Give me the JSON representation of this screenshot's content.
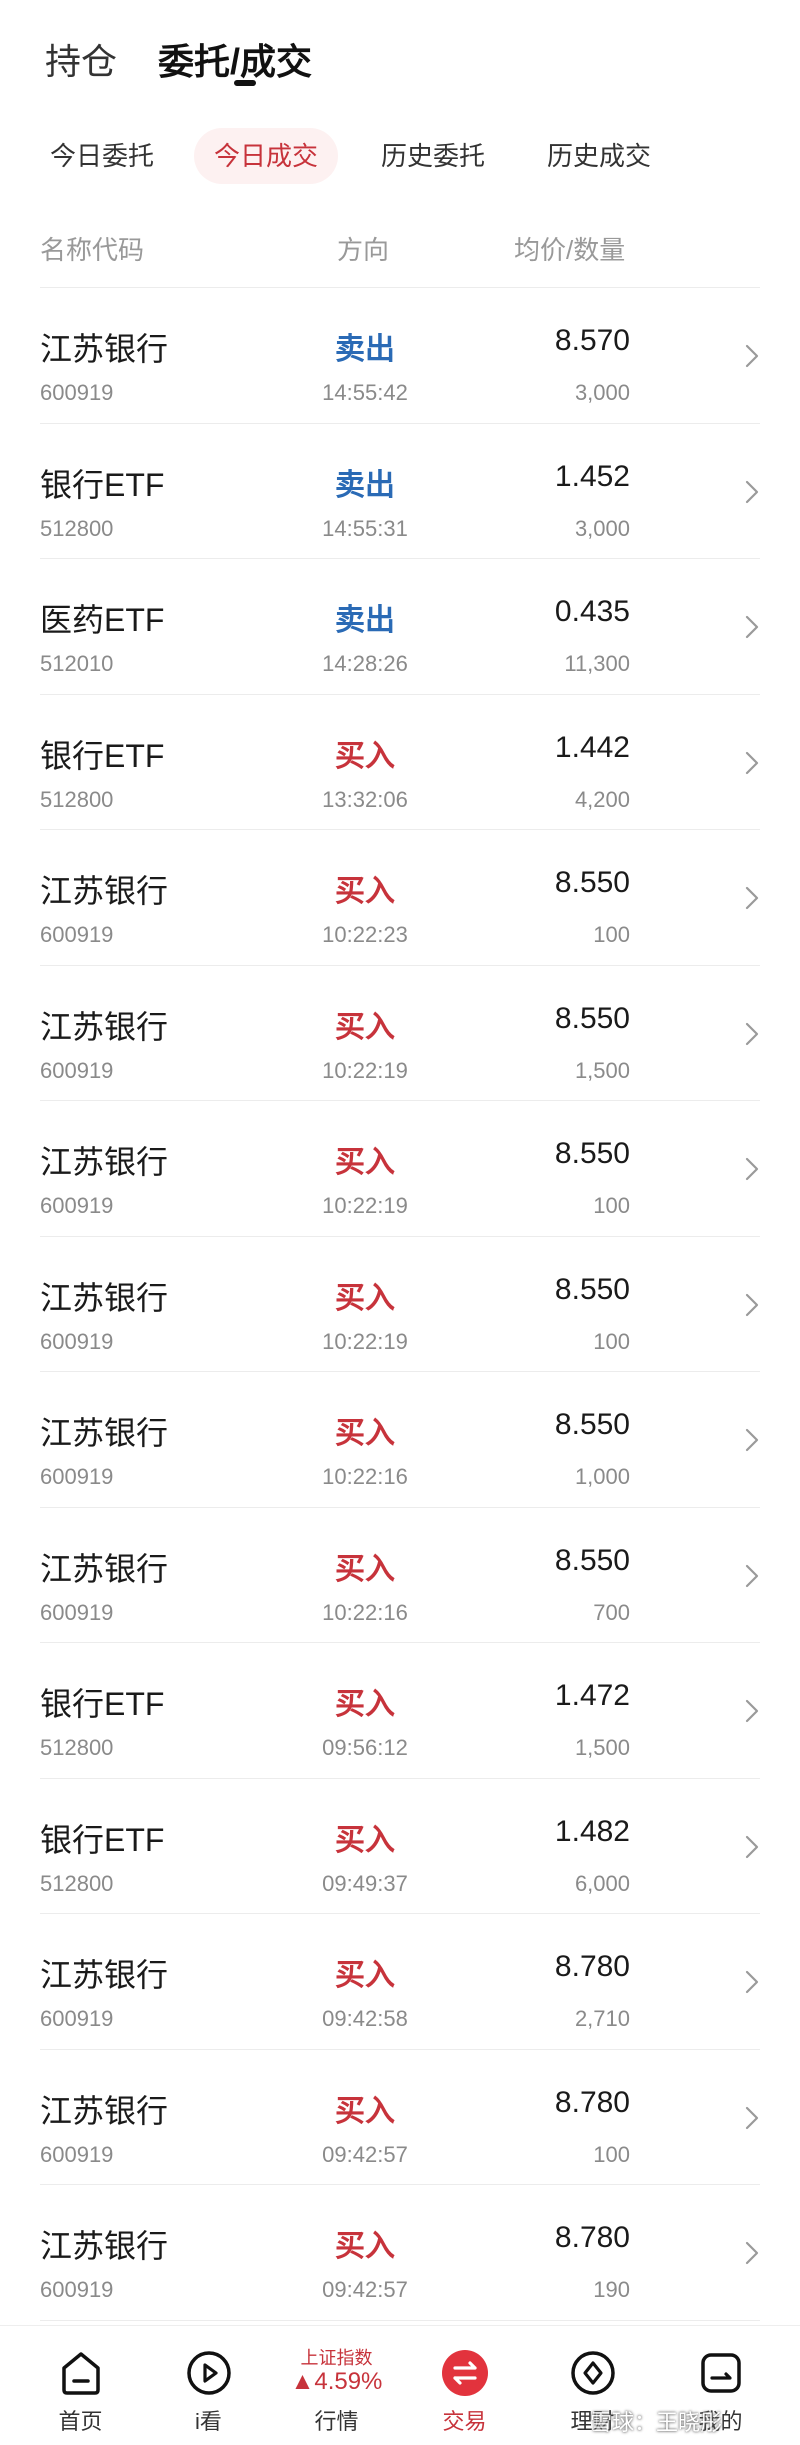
{
  "top_tabs": {
    "holdings": "持仓",
    "orders": "委托/成交"
  },
  "sub_tabs": [
    "今日委托",
    "今日成交",
    "历史委托",
    "历史成交"
  ],
  "active_sub_tab": 1,
  "columns": {
    "name_code": "名称代码",
    "direction": "方向",
    "price_qty": "均价/数量"
  },
  "colors": {
    "buy": "#c7333b",
    "sell": "#2a6ab5",
    "active_tab_bg": "#fdf1f1"
  },
  "trades": [
    {
      "name": "江苏银行",
      "code": "600919",
      "direction": "卖出",
      "side": "sell",
      "time": "14:55:42",
      "price": "8.570",
      "qty": "3,000"
    },
    {
      "name": "银行ETF",
      "code": "512800",
      "direction": "卖出",
      "side": "sell",
      "time": "14:55:31",
      "price": "1.452",
      "qty": "3,000"
    },
    {
      "name": "医药ETF",
      "code": "512010",
      "direction": "卖出",
      "side": "sell",
      "time": "14:28:26",
      "price": "0.435",
      "qty": "11,300"
    },
    {
      "name": "银行ETF",
      "code": "512800",
      "direction": "买入",
      "side": "buy",
      "time": "13:32:06",
      "price": "1.442",
      "qty": "4,200"
    },
    {
      "name": "江苏银行",
      "code": "600919",
      "direction": "买入",
      "side": "buy",
      "time": "10:22:23",
      "price": "8.550",
      "qty": "100"
    },
    {
      "name": "江苏银行",
      "code": "600919",
      "direction": "买入",
      "side": "buy",
      "time": "10:22:19",
      "price": "8.550",
      "qty": "1,500"
    },
    {
      "name": "江苏银行",
      "code": "600919",
      "direction": "买入",
      "side": "buy",
      "time": "10:22:19",
      "price": "8.550",
      "qty": "100"
    },
    {
      "name": "江苏银行",
      "code": "600919",
      "direction": "买入",
      "side": "buy",
      "time": "10:22:19",
      "price": "8.550",
      "qty": "100"
    },
    {
      "name": "江苏银行",
      "code": "600919",
      "direction": "买入",
      "side": "buy",
      "time": "10:22:16",
      "price": "8.550",
      "qty": "1,000"
    },
    {
      "name": "江苏银行",
      "code": "600919",
      "direction": "买入",
      "side": "buy",
      "time": "10:22:16",
      "price": "8.550",
      "qty": "700"
    },
    {
      "name": "银行ETF",
      "code": "512800",
      "direction": "买入",
      "side": "buy",
      "time": "09:56:12",
      "price": "1.472",
      "qty": "1,500"
    },
    {
      "name": "银行ETF",
      "code": "512800",
      "direction": "买入",
      "side": "buy",
      "time": "09:49:37",
      "price": "1.482",
      "qty": "6,000"
    },
    {
      "name": "江苏银行",
      "code": "600919",
      "direction": "买入",
      "side": "buy",
      "time": "09:42:58",
      "price": "8.780",
      "qty": "2,710"
    },
    {
      "name": "江苏银行",
      "code": "600919",
      "direction": "买入",
      "side": "buy",
      "time": "09:42:57",
      "price": "8.780",
      "qty": "100"
    },
    {
      "name": "江苏银行",
      "code": "600919",
      "direction": "买入",
      "side": "buy",
      "time": "09:42:57",
      "price": "8.780",
      "qty": "190"
    }
  ],
  "bottom_nav": {
    "home": "首页",
    "watch": "i看",
    "market_index_name": "上证指数",
    "market_index_change": "▲4.59%",
    "market": "行情",
    "trade": "交易",
    "finance": "理财",
    "mine": "我的"
  },
  "watermark": "雪球：王晓彤"
}
